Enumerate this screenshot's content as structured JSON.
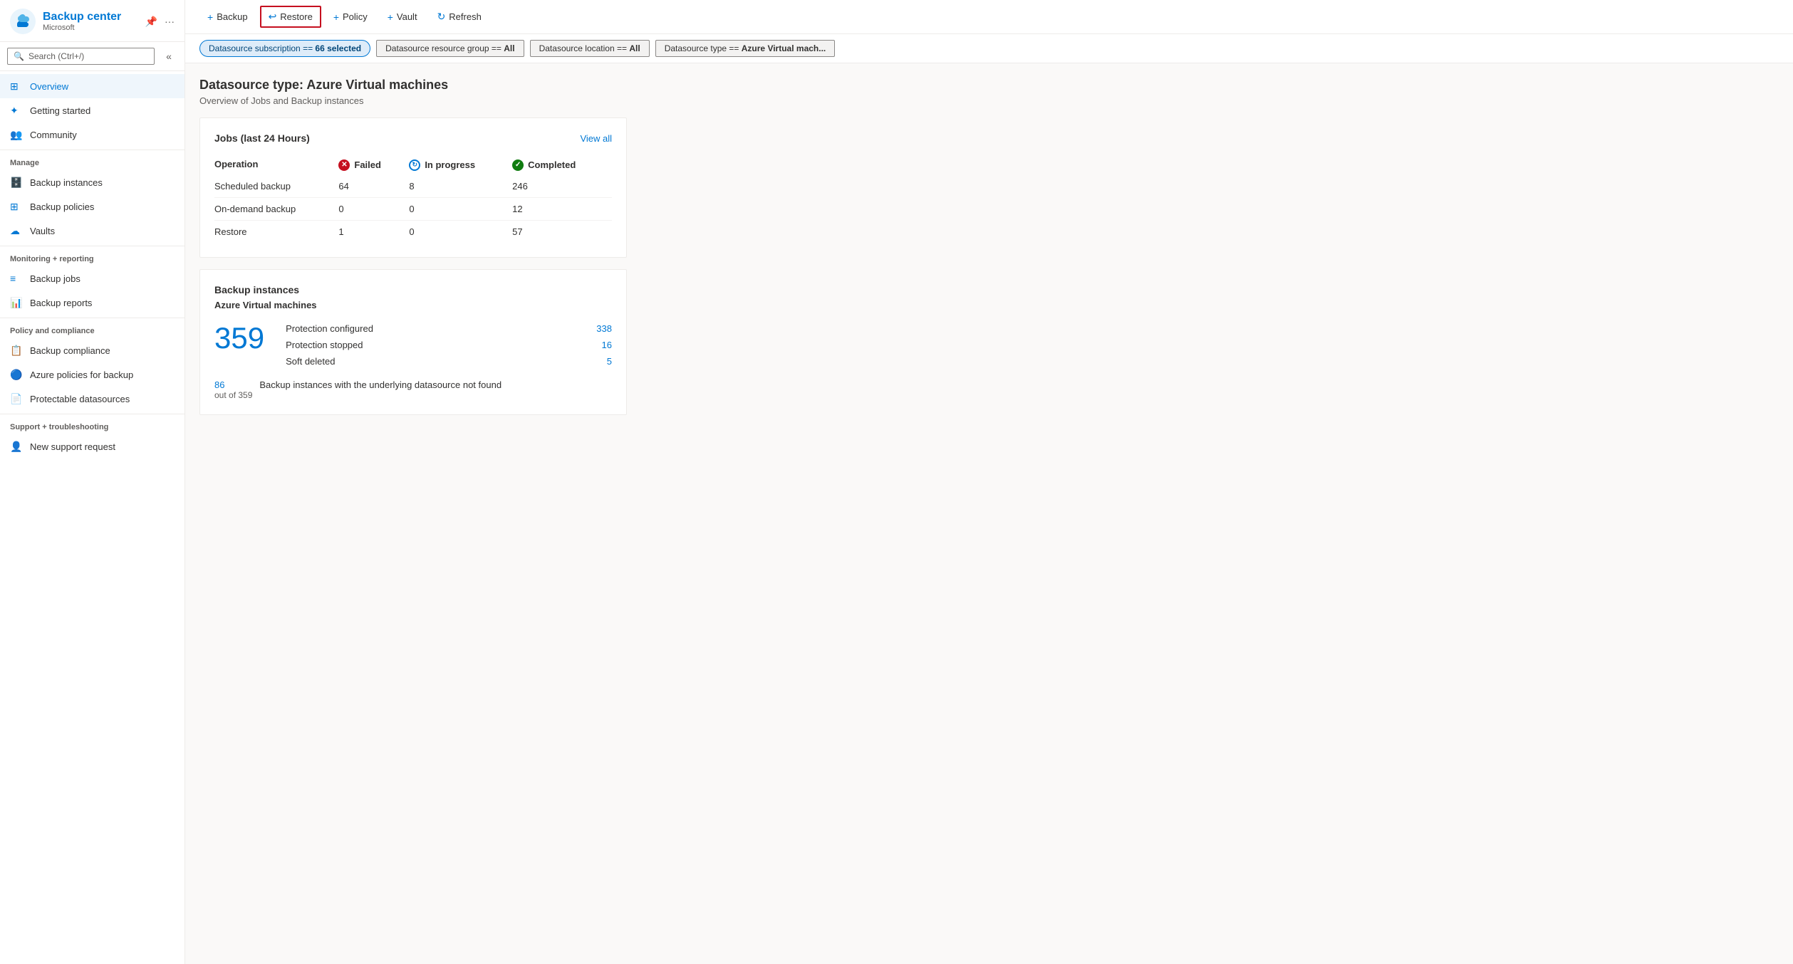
{
  "sidebar": {
    "app_title": "Backup center",
    "app_subtitle": "Microsoft",
    "search_placeholder": "Search (Ctrl+/)",
    "collapse_icon": "«",
    "nav": {
      "overview": "Overview",
      "getting_started": "Getting started",
      "community": "Community",
      "manage_label": "Manage",
      "backup_instances": "Backup instances",
      "backup_policies": "Backup policies",
      "vaults": "Vaults",
      "monitoring_label": "Monitoring + reporting",
      "backup_jobs": "Backup jobs",
      "backup_reports": "Backup reports",
      "policy_label": "Policy and compliance",
      "backup_compliance": "Backup compliance",
      "azure_policies": "Azure policies for backup",
      "protectable_datasources": "Protectable datasources",
      "support_label": "Support + troubleshooting",
      "new_support_request": "New support request"
    }
  },
  "toolbar": {
    "backup_label": "Backup",
    "restore_label": "Restore",
    "policy_label": "Policy",
    "vault_label": "Vault",
    "refresh_label": "Refresh"
  },
  "filters": {
    "subscription": "Datasource subscription == 66 selected",
    "resource_group": "Datasource resource group == All",
    "location": "Datasource location == All",
    "datasource_type": "Datasource type == Azure Virtual mach..."
  },
  "main": {
    "page_title": "Datasource type: Azure Virtual machines",
    "page_subtitle": "Overview of Jobs and Backup instances",
    "jobs_card": {
      "title": "Jobs (last 24 Hours)",
      "view_all": "View all",
      "columns": {
        "operation": "Operation",
        "failed": "Failed",
        "in_progress": "In progress",
        "completed": "Completed"
      },
      "rows": [
        {
          "operation": "Scheduled backup",
          "failed": "64",
          "failed_is_link": true,
          "in_progress": "8",
          "in_progress_is_link": true,
          "completed": "246",
          "completed_is_link": true
        },
        {
          "operation": "On-demand backup",
          "failed": "0",
          "failed_is_link": false,
          "in_progress": "0",
          "in_progress_is_link": false,
          "completed": "12",
          "completed_is_link": true
        },
        {
          "operation": "Restore",
          "failed": "1",
          "failed_is_link": true,
          "in_progress": "0",
          "in_progress_is_link": false,
          "completed": "57",
          "completed_is_link": true
        }
      ]
    },
    "instances_card": {
      "title": "Backup instances",
      "subtitle": "Azure Virtual machines",
      "total_count": "359",
      "stats": [
        {
          "label": "Protection configured",
          "value": "338"
        },
        {
          "label": "Protection stopped",
          "value": "16"
        },
        {
          "label": "Soft deleted",
          "value": "5"
        }
      ],
      "footer_count": "86",
      "footer_count_sub": "out of 359",
      "footer_label": "Backup instances with the underlying datasource not found"
    }
  }
}
